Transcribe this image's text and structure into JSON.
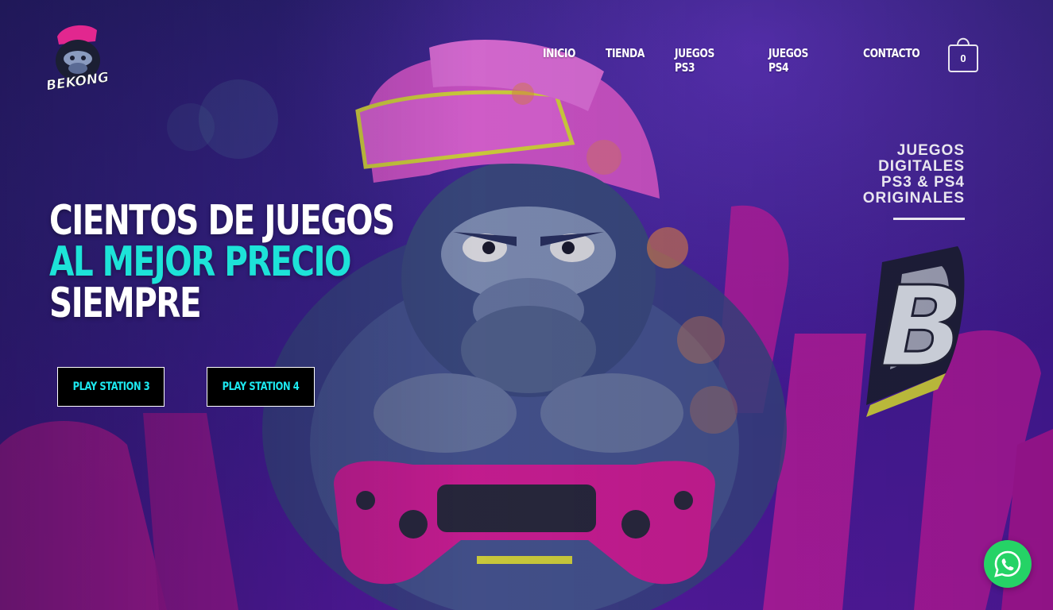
{
  "brand": {
    "logo_text": "BEKONG"
  },
  "nav": {
    "items": [
      {
        "label": "INICIO"
      },
      {
        "label": "TIENDA"
      },
      {
        "label": "JUEGOS PS3"
      },
      {
        "label": "JUEGOS PS4"
      },
      {
        "label": "CONTACTO"
      }
    ],
    "cart_count": "0"
  },
  "hero": {
    "line1": "CIENTOS DE JUEGOS",
    "line2": "AL MEJOR PRECIO",
    "line3": "SIEMPRE",
    "buttons": {
      "ps3": "PLAY STATION 3",
      "ps4": "PLAY STATION 4"
    },
    "tagline": [
      "JUEGOS",
      "DIGITALES",
      "PS3 & PS4",
      "ORIGINALES"
    ],
    "badge_letter": "B"
  },
  "colors": {
    "accent": "#1de3d8",
    "magenta": "#e21ea8",
    "background": "#3a1f86",
    "whatsapp": "#25d366"
  },
  "icons": {
    "cart": "shopping-bag-icon",
    "whatsapp": "whatsapp-icon"
  }
}
